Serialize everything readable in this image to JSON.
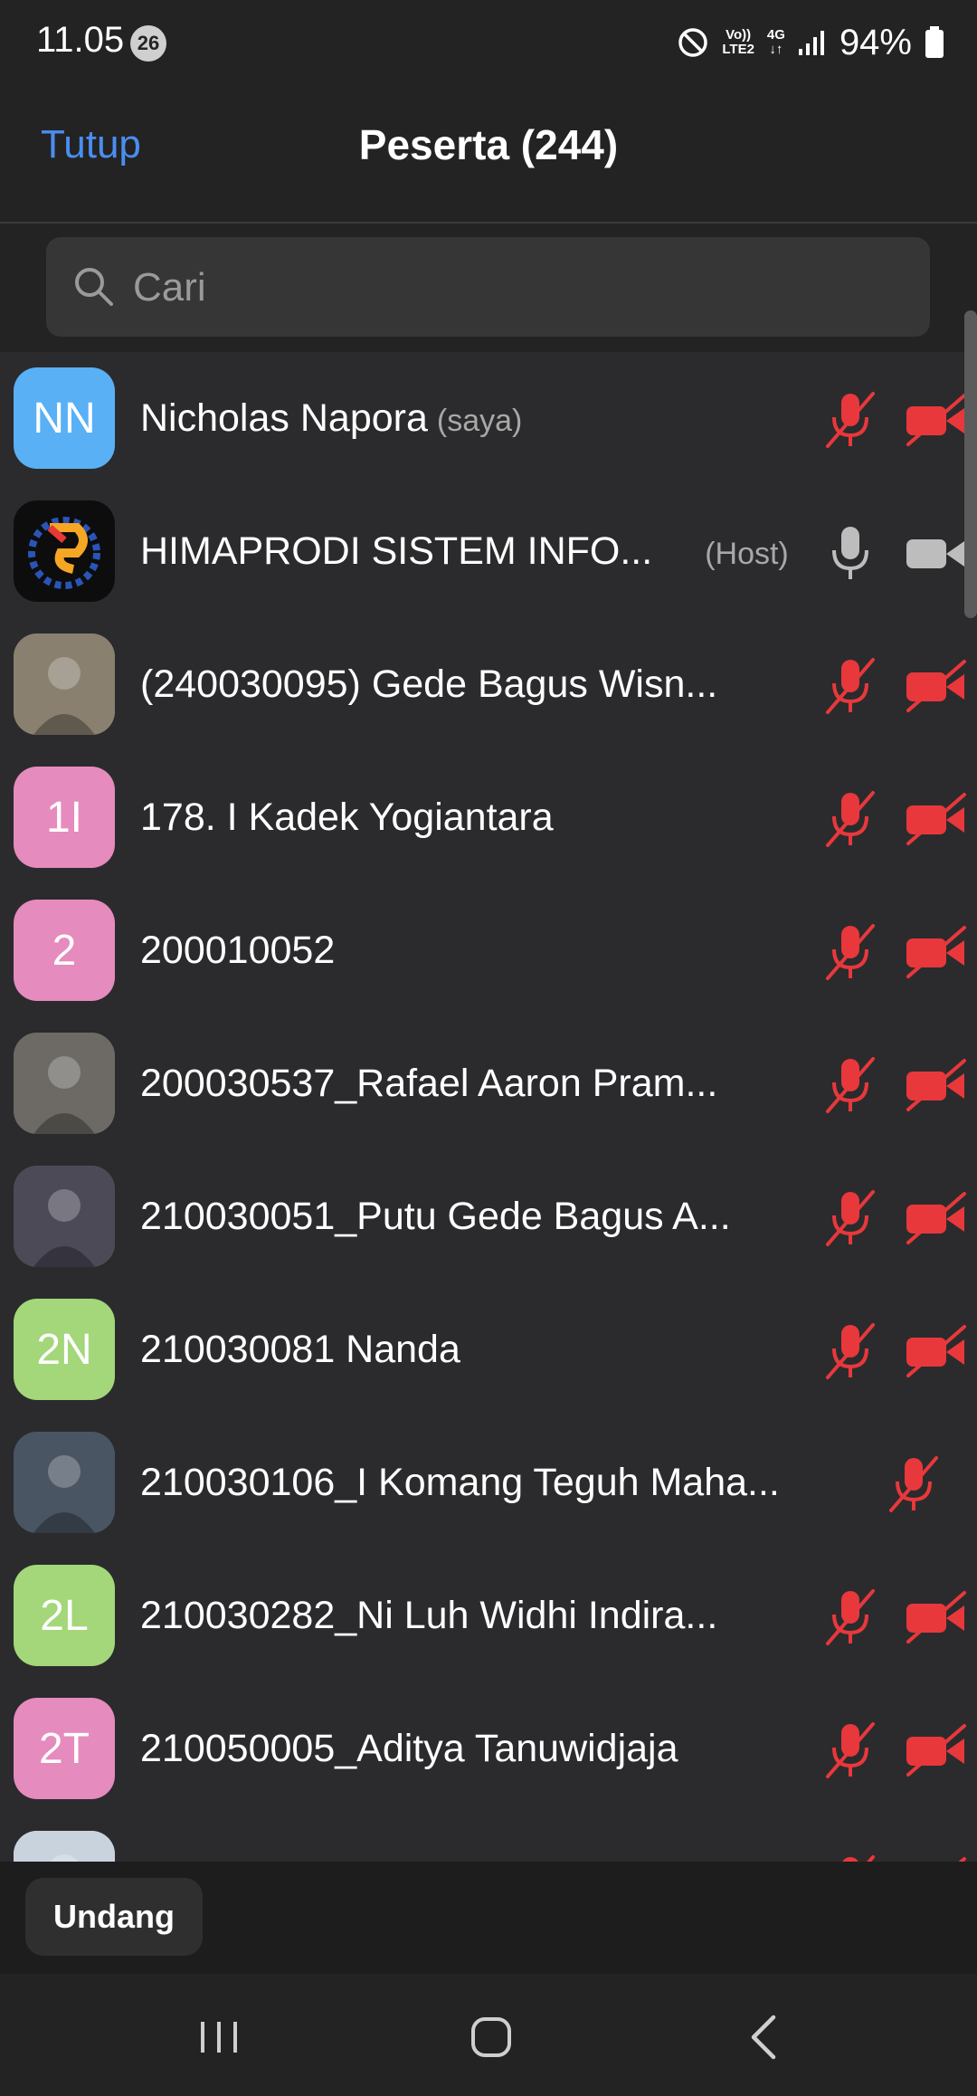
{
  "status_bar": {
    "time": "11.05",
    "notification_count": "26",
    "network_volte": "Vo))",
    "network_lte": "LTE2",
    "network_type": "4G",
    "battery": "94%"
  },
  "header": {
    "close_label": "Tutup",
    "title": "Peserta (244)"
  },
  "search": {
    "placeholder": "Cari"
  },
  "participants": [
    {
      "initials": "NN",
      "avatar_color": "#59b0f5",
      "name": "Nicholas Napora",
      "tag": "(saya)",
      "mic": "muted",
      "video": "off"
    },
    {
      "initials": "",
      "avatar_color": "#0d0d0d",
      "avatar_icon": "himaprodi-logo",
      "name": "HIMAPRODI SISTEM INFO...",
      "tag": "(Host)",
      "mic": "on",
      "video": "on"
    },
    {
      "initials": "",
      "avatar_color": "#8a8070",
      "avatar_icon": "photo",
      "name": "(240030095) Gede Bagus Wisn...",
      "tag": "",
      "mic": "muted",
      "video": "off"
    },
    {
      "initials": "1I",
      "avatar_color": "#e58bbd",
      "name": "178. I Kadek Yogiantara",
      "tag": "",
      "mic": "muted",
      "video": "off"
    },
    {
      "initials": "2",
      "avatar_color": "#e58bbd",
      "name": "200010052",
      "tag": "",
      "mic": "muted",
      "video": "off"
    },
    {
      "initials": "",
      "avatar_color": "#6d6a66",
      "avatar_icon": "photo",
      "name": "200030537_Rafael Aaron Pram...",
      "tag": "",
      "mic": "muted",
      "video": "off"
    },
    {
      "initials": "",
      "avatar_color": "#4d4a58",
      "avatar_icon": "photo",
      "name": "210030051_Putu Gede Bagus A...",
      "tag": "",
      "mic": "muted",
      "video": "off"
    },
    {
      "initials": "2N",
      "avatar_color": "#a3d77a",
      "name": "210030081 Nanda",
      "tag": "",
      "mic": "muted",
      "video": "off"
    },
    {
      "initials": "",
      "avatar_color": "#4a5563",
      "avatar_icon": "photo",
      "name": "210030106_I Komang Teguh Maha...",
      "tag": "",
      "mic": "muted",
      "video": "none"
    },
    {
      "initials": "2L",
      "avatar_color": "#a3d77a",
      "name": "210030282_Ni Luh Widhi Indira...",
      "tag": "",
      "mic": "muted",
      "video": "off"
    },
    {
      "initials": "2T",
      "avatar_color": "#e58bbd",
      "name": "210050005_Aditya Tanuwidjaja",
      "tag": "",
      "mic": "muted",
      "video": "off"
    },
    {
      "initials": "",
      "avatar_color": "#c9d3de",
      "avatar_icon": "photo",
      "name": "",
      "tag": "",
      "mic": "muted",
      "video": "off"
    }
  ],
  "footer": {
    "invite_label": "Undang"
  },
  "colors": {
    "accent": "#4a8ef0",
    "muted_red": "#e8383c",
    "icon_gray": "#bdbdbd"
  }
}
